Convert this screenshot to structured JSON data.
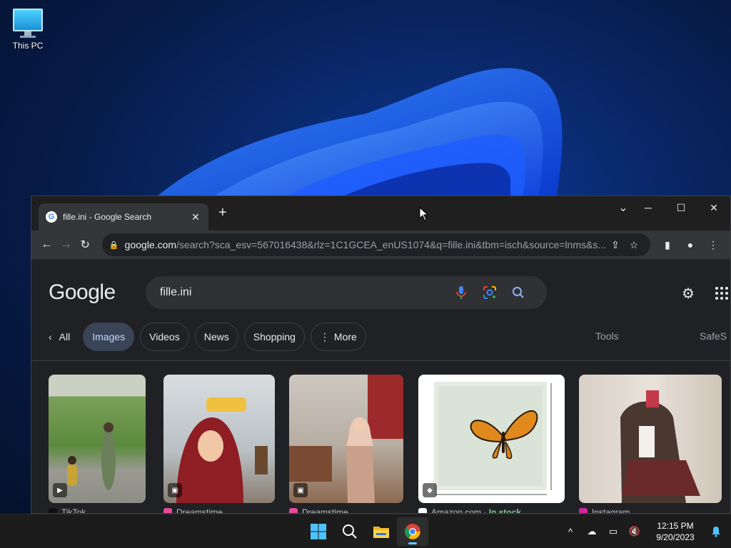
{
  "desktop": {
    "icons": [
      {
        "label": "This PC",
        "icon": "monitor-icon"
      }
    ]
  },
  "browser": {
    "tab": {
      "title": "fille.ini - Google Search",
      "favicon": "G"
    },
    "address": {
      "host": "google.com",
      "path": "/search?sca_esv=567016438&rlz=1C1GCEA_enUS1074&q=fille.ini&tbm=isch&source=lnms&s..."
    }
  },
  "google": {
    "logo": "Google",
    "query": "fille.ini",
    "tabs": [
      {
        "label": "All"
      },
      {
        "label": "Images"
      },
      {
        "label": "Videos"
      },
      {
        "label": "News"
      },
      {
        "label": "Shopping"
      },
      {
        "label": "More"
      }
    ],
    "tools": "Tools",
    "safesearch": "SafeS",
    "results": [
      {
        "source": "TikTok",
        "extra": ""
      },
      {
        "source": "Dreamstime",
        "extra": ""
      },
      {
        "source": "Dreamstime",
        "extra": ""
      },
      {
        "source": "Amazon.com",
        "extra": "In stock"
      },
      {
        "source": "Instagram",
        "extra": ""
      }
    ]
  },
  "taskbar": {
    "time": "12:15 PM",
    "date": "9/20/2023"
  },
  "colors": {
    "accent": "#8ab4f8",
    "active_chip": "#394457",
    "in_stock": "#81c995"
  }
}
